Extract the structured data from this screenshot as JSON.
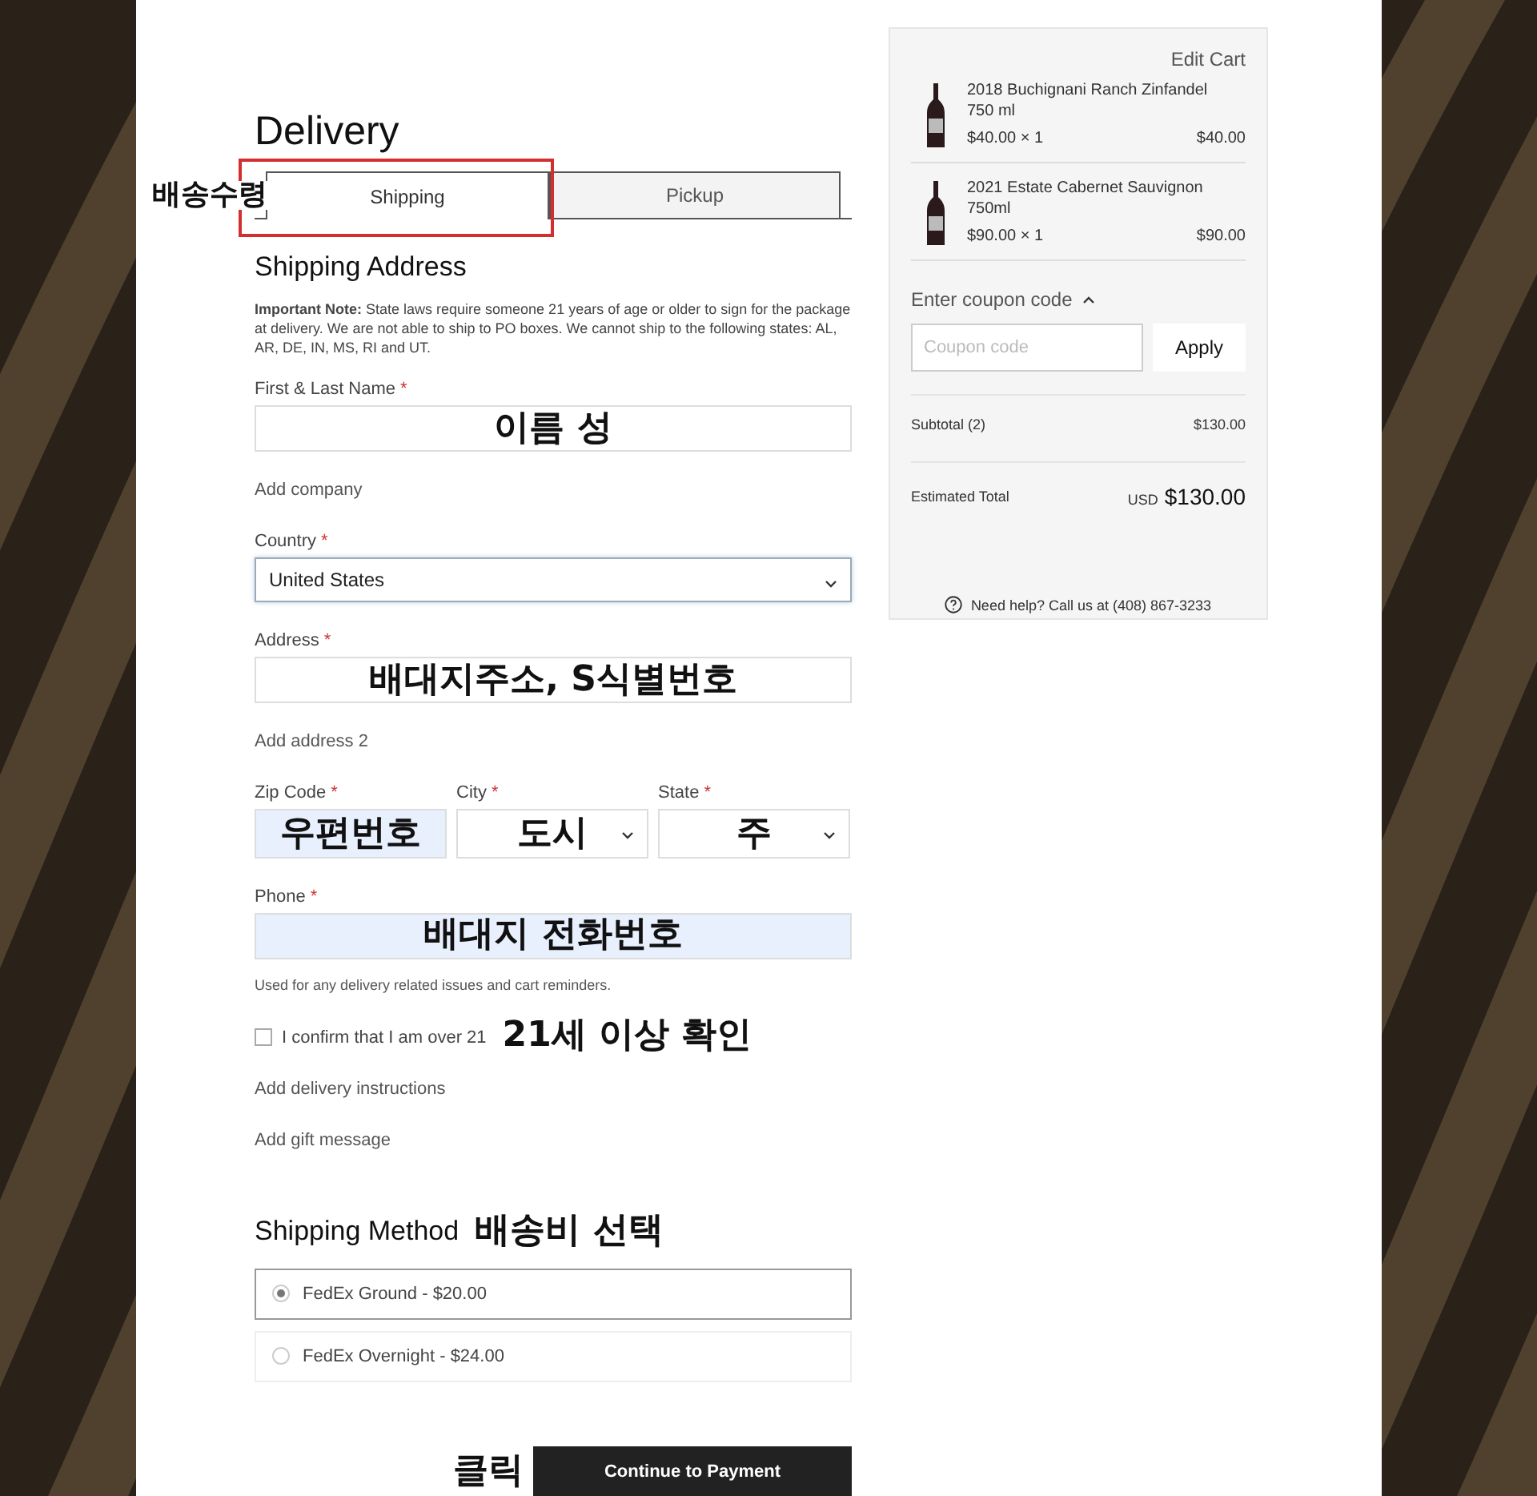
{
  "heading": "Delivery",
  "tabs": [
    {
      "label": "Shipping",
      "selected": true,
      "annotation": "배송수령"
    },
    {
      "label": "Pickup",
      "selected": false
    }
  ],
  "address_section": {
    "title": "Shipping Address",
    "note": "**Important Note:** State laws require someone 21 years of age or older to sign for the package at delivery. We are not able to ship to PO boxes. We cannot ship to the following states: AL, AR, DE, IN, MS, RI and UT."
  },
  "form": [
    {
      "kind": "input",
      "label": "First & Last Name",
      "required": "*",
      "annotation": "이름 성",
      "autofilled": false
    },
    {
      "kind": "link",
      "label": "Add company"
    },
    {
      "kind": "select",
      "label": "Country",
      "required": "*",
      "value": "United States",
      "focused": true
    },
    {
      "kind": "input",
      "label": "Address",
      "required": "*",
      "annotation": "배대지주소, S식별번호",
      "autofilled": false
    },
    {
      "kind": "link",
      "label": "Add address 2"
    },
    {
      "kind": "row",
      "fields": [
        {
          "kind": "input",
          "label": "Zip Code",
          "required": "*",
          "annotation": "우편번호",
          "autofilled": true
        },
        {
          "kind": "select",
          "label": "City",
          "required": "*",
          "annotation": "도시",
          "focused": false
        },
        {
          "kind": "select",
          "label": "State",
          "required": "*",
          "annotation": "주",
          "focused": false
        }
      ]
    },
    {
      "kind": "input",
      "label": "Phone",
      "required": "*",
      "annotation": "배대지 전화번호",
      "autofilled": true
    },
    {
      "kind": "hint",
      "text": "Used for any delivery related issues and cart reminders."
    },
    {
      "kind": "checkbox",
      "label": "I confirm that I am over 21",
      "checked": false,
      "annotation": "21세 이상 확인"
    },
    {
      "kind": "link",
      "label": "Add delivery instructions"
    },
    {
      "kind": "link",
      "label": "Add gift message"
    }
  ],
  "shipping_method": {
    "title": "Shipping Method",
    "annotation": "배송비 선택",
    "options": [
      {
        "label": "FedEx Ground - $20.00",
        "selected": true
      },
      {
        "label": "FedEx Overnight - $24.00",
        "selected": false
      }
    ]
  },
  "submit": {
    "label": "Continue to Payment",
    "annotation": "클릭"
  },
  "summary": {
    "edit_link": "Edit Cart",
    "items": [
      {
        "name": "2018 Buchignani Ranch Zinfandel",
        "size": "750 ml",
        "price_qty": "$40.00 × 1",
        "total": "$40.00"
      },
      {
        "name": "2021 Estate Cabernet Sauvignon",
        "size": "750ml",
        "price_qty": "$90.00 × 1",
        "total": "$90.00"
      }
    ],
    "coupon": {
      "toggle": "Enter coupon code",
      "expanded": true,
      "placeholder": "Coupon code",
      "button": "Apply"
    },
    "subtotal": {
      "label": "Subtotal (2)",
      "value": "$130.00"
    },
    "total": {
      "label": "Estimated Total",
      "currency": "USD",
      "value": "$130.00"
    },
    "help": "Need help? Call us at (408) 867-3233"
  }
}
